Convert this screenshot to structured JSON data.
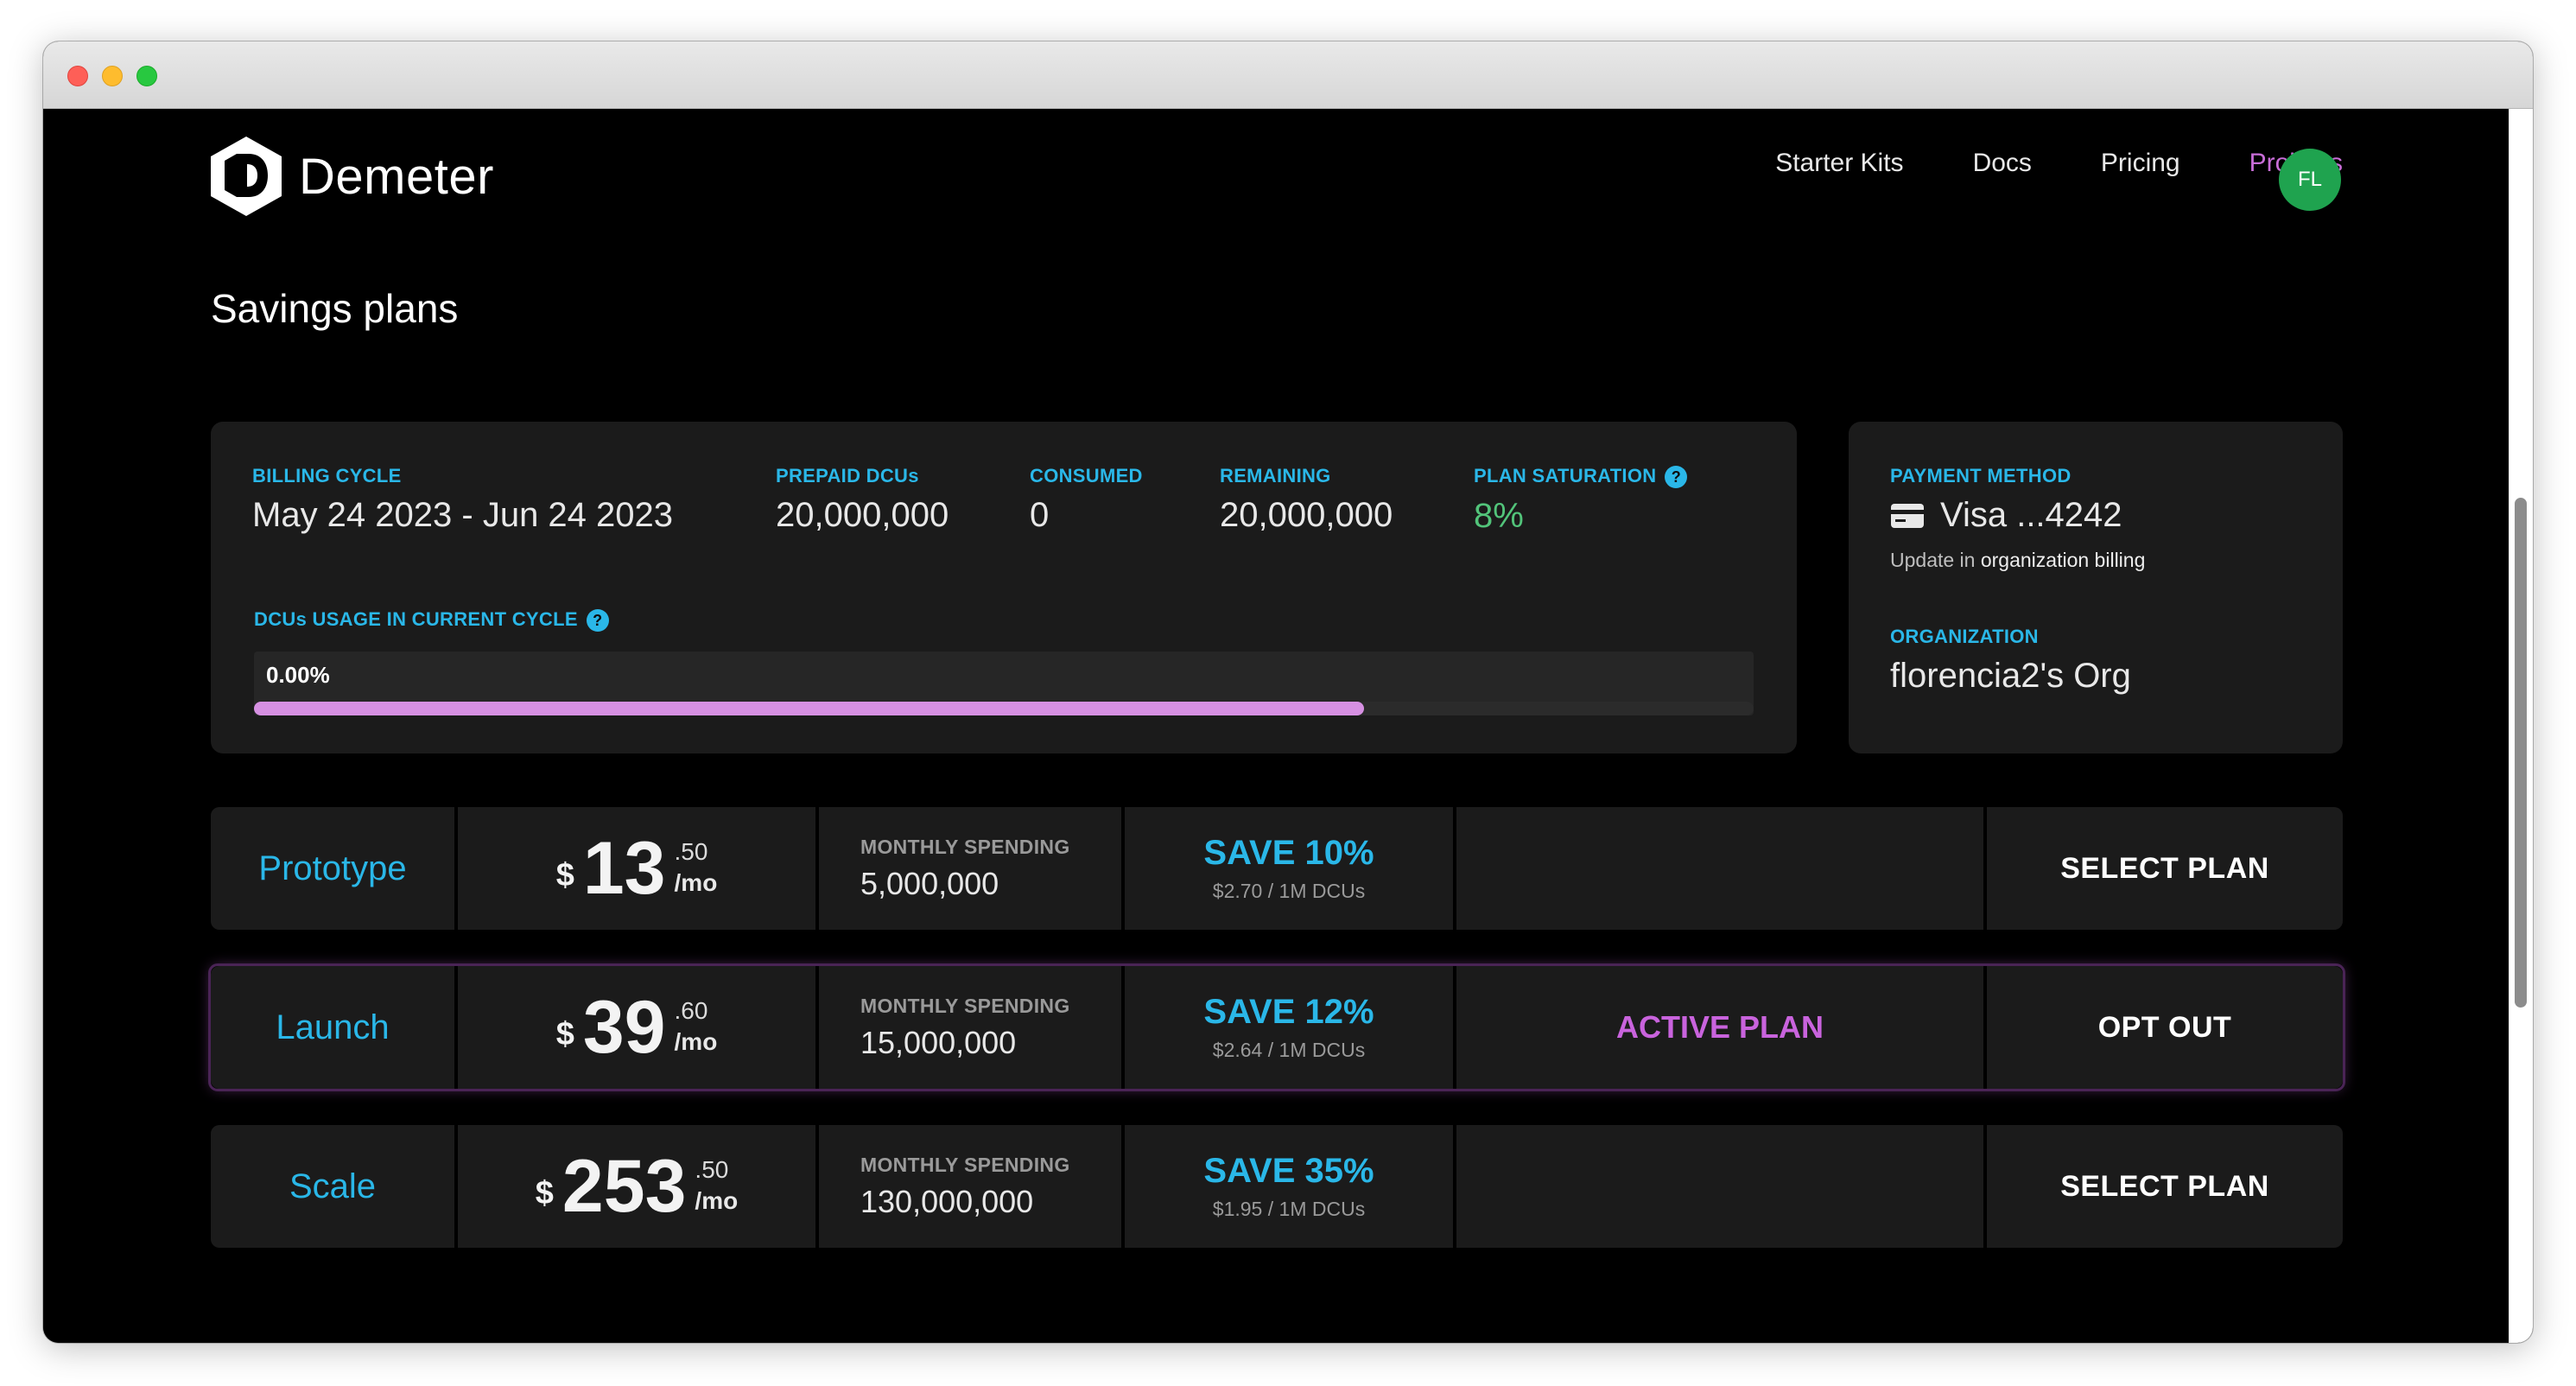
{
  "header": {
    "logo_text": "Demeter",
    "nav": [
      "Starter Kits",
      "Docs",
      "Pricing",
      "Projects"
    ],
    "active_nav": "Projects",
    "avatar_initials": "FL"
  },
  "page_title": "Savings plans",
  "summary": {
    "billing_cycle_label": "BILLING CYCLE",
    "billing_cycle": "May 24 2023 - Jun 24 2023",
    "prepaid_label": "PREPAID DCUs",
    "prepaid": "20,000,000",
    "consumed_label": "CONSUMED",
    "consumed": "0",
    "remaining_label": "REMAINING",
    "remaining": "20,000,000",
    "saturation_label": "PLAN SATURATION",
    "saturation": "8%",
    "usage_label": "DCUs USAGE IN CURRENT CYCLE",
    "usage_percent": "0.00%",
    "usage_bar_fill_fraction": 0.74
  },
  "payment": {
    "method_label": "PAYMENT METHOD",
    "method": "Visa ...4242",
    "update_prefix": "Update in",
    "update_link": "organization billing",
    "org_label": "ORGANIZATION",
    "org": "florencia2's Org"
  },
  "plans": [
    {
      "name": "Prototype",
      "currency": "$",
      "price_int": "13",
      "price_cents": ".50",
      "per": "/mo",
      "spend_label": "MONTHLY SPENDING",
      "spend": "5,000,000",
      "save": "SAVE 10%",
      "save_detail": "$2.70 / 1M DCUs",
      "status": "",
      "action": "SELECT PLAN"
    },
    {
      "name": "Launch",
      "currency": "$",
      "price_int": "39",
      "price_cents": ".60",
      "per": "/mo",
      "spend_label": "MONTHLY SPENDING",
      "spend": "15,000,000",
      "save": "SAVE 12%",
      "save_detail": "$2.64 / 1M DCUs",
      "status": "ACTIVE PLAN",
      "action": "OPT OUT"
    },
    {
      "name": "Scale",
      "currency": "$",
      "price_int": "253",
      "price_cents": ".50",
      "per": "/mo",
      "spend_label": "MONTHLY SPENDING",
      "spend": "130,000,000",
      "save": "SAVE 35%",
      "save_detail": "$1.95 / 1M DCUs",
      "status": "",
      "action": "SELECT PLAN"
    }
  ],
  "colors": {
    "accent_blue": "#2ab7e8",
    "accent_purple": "#c86dd7",
    "saturation_green": "#52c47a",
    "avatar_green": "#1fa34f",
    "bar_fill": "#d690e2"
  }
}
